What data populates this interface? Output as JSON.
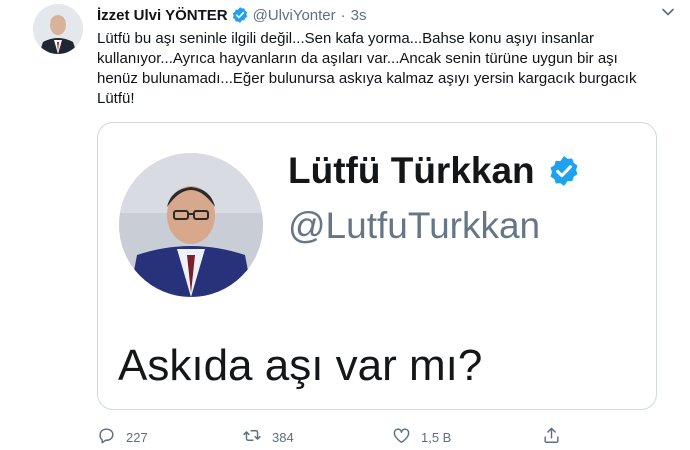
{
  "tweet": {
    "author": {
      "name": "İzzet Ulvi YÖNTER",
      "handle": "@UlviYonter",
      "time": "3s",
      "separator": "·",
      "verified": true
    },
    "text": "Lütfü bu aşı seninle ilgili değil...Sen kafa yorma...Bahse konu aşıyı insanlar kullanıyor...Ayrıca hayvanların da aşıları var...Ancak senin türüne uygun bir aşı henüz bulunamadı...Eğer bulunursa askıya kalmaz aşıyı yersin kargacık burgacık Lütfü!",
    "embedded_image": {
      "name": "Lütfü Türkkan",
      "handle": "@LutfuTurkkan",
      "text": "Askıda aşı var mı?",
      "verified": true
    },
    "actions": {
      "replies": "227",
      "retweets": "384",
      "likes": "1,5 B"
    }
  },
  "icons": {
    "verified": "verified-badge-icon",
    "reply": "reply-icon",
    "retweet": "retweet-icon",
    "like": "heart-icon",
    "share": "share-icon",
    "more": "more-icon"
  },
  "colors": {
    "accent": "#1da1f2",
    "muted": "#5b7083",
    "border": "#cfd9de"
  }
}
